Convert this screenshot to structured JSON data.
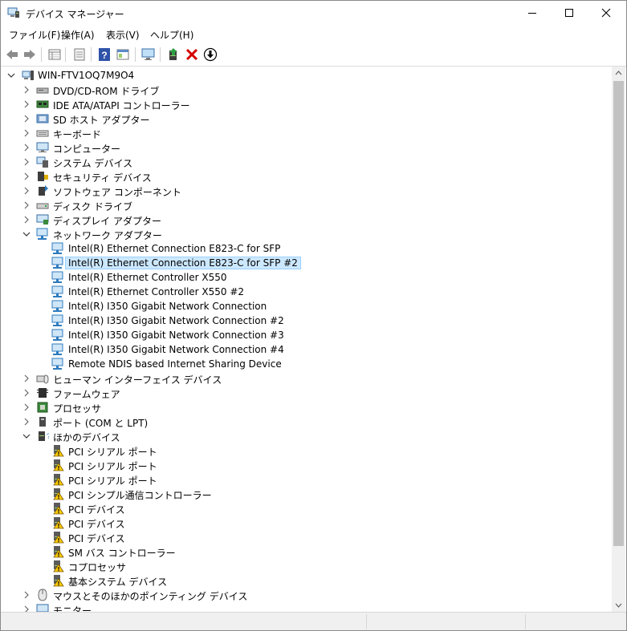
{
  "window": {
    "title": "デバイス マネージャー"
  },
  "menu": [
    "ファイル(F)",
    "操作(A)",
    "表示(V)",
    "ヘルプ(H)"
  ],
  "toolbar": {
    "icons": [
      "back-arrow-icon",
      "forward-arrow-icon",
      "properties-grid-icon",
      "driver-list-icon",
      "help-icon",
      "action-view-icon",
      "monitor-scan-icon",
      "update-driver-icon",
      "uninstall-icon",
      "download-icon"
    ]
  },
  "colors": {
    "selection_bg": "#cce8ff",
    "selection_border": "#99d1ff",
    "uninstall_red": "#d40000"
  },
  "tree": {
    "root": "WIN-FTV1OQ7M9O4",
    "categories": [
      "DVD/CD-ROM ドライブ",
      "IDE ATA/ATAPI コントローラー",
      "SD ホスト アダプター",
      "キーボード",
      "コンピューター",
      "システム デバイス",
      "セキュリティ デバイス",
      "ソフトウェア コンポーネント",
      "ディスク ドライブ",
      "ディスプレイ アダプター",
      "ネットワーク アダプター",
      "ヒューマン インターフェイス デバイス",
      "ファームウェア",
      "プロセッサ",
      "ポート (COM と LPT)",
      "ほかのデバイス",
      "マウスとそのほかのポインティング デバイス",
      "モニター"
    ],
    "network_children": [
      "Intel(R) Ethernet Connection E823-C for SFP",
      "Intel(R) Ethernet Connection E823-C for SFP #2",
      "Intel(R) Ethernet Controller X550",
      "Intel(R) Ethernet Controller X550 #2",
      "Intel(R) I350 Gigabit Network Connection",
      "Intel(R) I350 Gigabit Network Connection #2",
      "Intel(R) I350 Gigabit Network Connection #3",
      "Intel(R) I350 Gigabit Network Connection #4",
      "Remote NDIS based Internet Sharing Device"
    ],
    "other_children": [
      "PCI シリアル ポート",
      "PCI シリアル ポート",
      "PCI シリアル ポート",
      "PCI シンプル通信コントローラー",
      "PCI デバイス",
      "PCI デバイス",
      "PCI デバイス",
      "SM バス コントローラー",
      "コプロセッサ",
      "基本システム デバイス"
    ]
  }
}
